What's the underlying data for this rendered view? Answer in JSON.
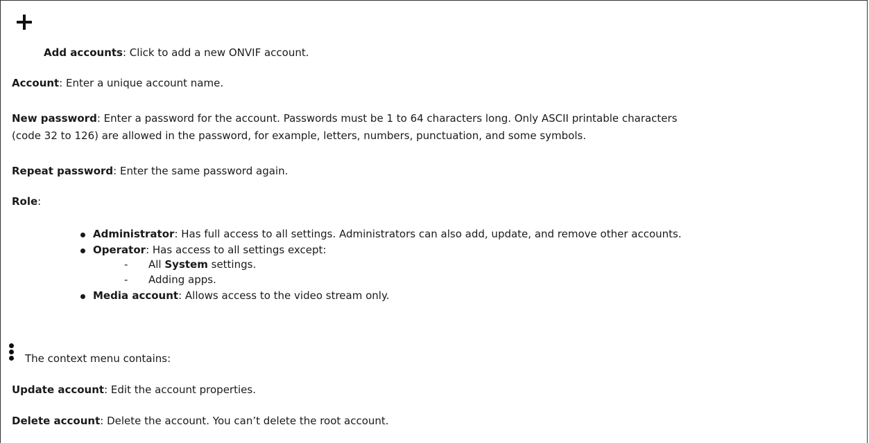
{
  "add": {
    "icon": "plus-icon",
    "label": "Add accounts",
    "text": ": Click to add a new ONVIF account."
  },
  "account": {
    "label": "Account",
    "text": ": Enter a unique account name."
  },
  "new_password": {
    "label": "New password",
    "text_line1": ": Enter a password for the account. Passwords must be 1 to 64 characters long. Only ASCII printable characters",
    "text_line2": "(code 32 to 126) are allowed in the password, for example, letters, numbers, punctuation, and some symbols."
  },
  "repeat_password": {
    "label": "Repeat password",
    "text": ": Enter the same password again."
  },
  "role": {
    "label": "Role",
    "suffix": ":",
    "items": [
      {
        "label": "Administrator",
        "text": ": Has full access to all settings. Administrators can also add, update, and remove other accounts."
      },
      {
        "label": "Operator",
        "text": ": Has access to all settings except:",
        "sub": [
          {
            "dash": "-",
            "pre": "All ",
            "bold": "System",
            "post": " settings."
          },
          {
            "dash": "-",
            "text": "Adding apps."
          }
        ]
      },
      {
        "label": "Media account",
        "text": ": Allows access to the video stream only."
      }
    ]
  },
  "context": {
    "icon": "more-vertical-icon",
    "text": "The context menu contains:"
  },
  "update_account": {
    "label": "Update account",
    "text": ": Edit the account properties."
  },
  "delete_account": {
    "label": "Delete account",
    "text": ": Delete the account. You can’t delete the root account."
  }
}
